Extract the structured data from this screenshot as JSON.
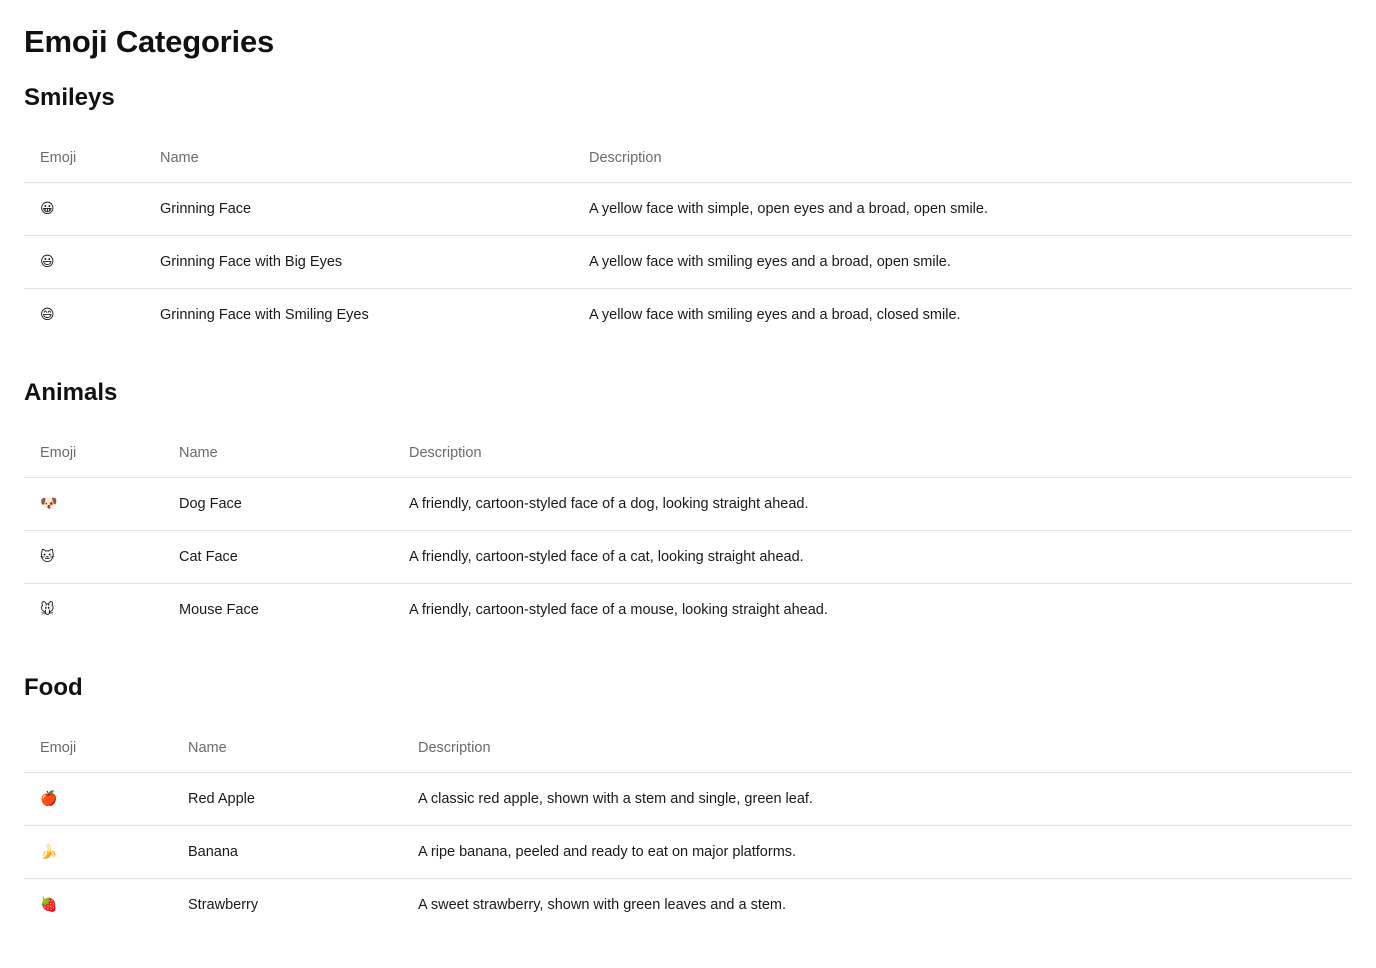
{
  "page": {
    "title": "Emoji Categories"
  },
  "headers": {
    "emoji": "Emoji",
    "name": "Name",
    "description": "Description"
  },
  "sections": [
    {
      "title": "Smileys",
      "rows": [
        {
          "emoji": "😀",
          "name": "Grinning Face",
          "description": "A yellow face with simple, open eyes and a broad, open smile."
        },
        {
          "emoji": "😃",
          "name": "Grinning Face with Big Eyes",
          "description": "A yellow face with smiling eyes and a broad, open smile."
        },
        {
          "emoji": "😄",
          "name": "Grinning Face with Smiling Eyes",
          "description": "A yellow face with smiling eyes and a broad, closed smile."
        }
      ]
    },
    {
      "title": "Animals",
      "rows": [
        {
          "emoji": "🐶",
          "name": "Dog Face",
          "description": "A friendly, cartoon-styled face of a dog, looking straight ahead."
        },
        {
          "emoji": "🐱",
          "name": "Cat Face",
          "description": "A friendly, cartoon-styled face of a cat, looking straight ahead."
        },
        {
          "emoji": "🐭",
          "name": "Mouse Face",
          "description": "A friendly, cartoon-styled face of a mouse, looking straight ahead."
        }
      ]
    },
    {
      "title": "Food",
      "rows": [
        {
          "emoji": "🍎",
          "name": "Red Apple",
          "description": "A classic red apple, shown with a stem and single, green leaf."
        },
        {
          "emoji": "🍌",
          "name": "Banana",
          "description": "A ripe banana, peeled and ready to eat on major platforms."
        },
        {
          "emoji": "🍓",
          "name": "Strawberry",
          "description": "A sweet strawberry, shown with green leaves and a stem."
        }
      ]
    }
  ]
}
